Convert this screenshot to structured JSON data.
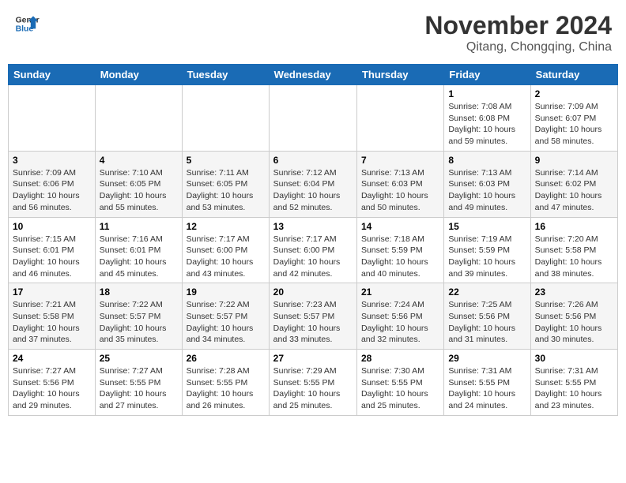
{
  "header": {
    "logo_line1": "General",
    "logo_line2": "Blue",
    "month": "November 2024",
    "location": "Qitang, Chongqing, China"
  },
  "weekdays": [
    "Sunday",
    "Monday",
    "Tuesday",
    "Wednesday",
    "Thursday",
    "Friday",
    "Saturday"
  ],
  "weeks": [
    [
      {
        "day": "",
        "info": ""
      },
      {
        "day": "",
        "info": ""
      },
      {
        "day": "",
        "info": ""
      },
      {
        "day": "",
        "info": ""
      },
      {
        "day": "",
        "info": ""
      },
      {
        "day": "1",
        "info": "Sunrise: 7:08 AM\nSunset: 6:08 PM\nDaylight: 10 hours and 59 minutes."
      },
      {
        "day": "2",
        "info": "Sunrise: 7:09 AM\nSunset: 6:07 PM\nDaylight: 10 hours and 58 minutes."
      }
    ],
    [
      {
        "day": "3",
        "info": "Sunrise: 7:09 AM\nSunset: 6:06 PM\nDaylight: 10 hours and 56 minutes."
      },
      {
        "day": "4",
        "info": "Sunrise: 7:10 AM\nSunset: 6:05 PM\nDaylight: 10 hours and 55 minutes."
      },
      {
        "day": "5",
        "info": "Sunrise: 7:11 AM\nSunset: 6:05 PM\nDaylight: 10 hours and 53 minutes."
      },
      {
        "day": "6",
        "info": "Sunrise: 7:12 AM\nSunset: 6:04 PM\nDaylight: 10 hours and 52 minutes."
      },
      {
        "day": "7",
        "info": "Sunrise: 7:13 AM\nSunset: 6:03 PM\nDaylight: 10 hours and 50 minutes."
      },
      {
        "day": "8",
        "info": "Sunrise: 7:13 AM\nSunset: 6:03 PM\nDaylight: 10 hours and 49 minutes."
      },
      {
        "day": "9",
        "info": "Sunrise: 7:14 AM\nSunset: 6:02 PM\nDaylight: 10 hours and 47 minutes."
      }
    ],
    [
      {
        "day": "10",
        "info": "Sunrise: 7:15 AM\nSunset: 6:01 PM\nDaylight: 10 hours and 46 minutes."
      },
      {
        "day": "11",
        "info": "Sunrise: 7:16 AM\nSunset: 6:01 PM\nDaylight: 10 hours and 45 minutes."
      },
      {
        "day": "12",
        "info": "Sunrise: 7:17 AM\nSunset: 6:00 PM\nDaylight: 10 hours and 43 minutes."
      },
      {
        "day": "13",
        "info": "Sunrise: 7:17 AM\nSunset: 6:00 PM\nDaylight: 10 hours and 42 minutes."
      },
      {
        "day": "14",
        "info": "Sunrise: 7:18 AM\nSunset: 5:59 PM\nDaylight: 10 hours and 40 minutes."
      },
      {
        "day": "15",
        "info": "Sunrise: 7:19 AM\nSunset: 5:59 PM\nDaylight: 10 hours and 39 minutes."
      },
      {
        "day": "16",
        "info": "Sunrise: 7:20 AM\nSunset: 5:58 PM\nDaylight: 10 hours and 38 minutes."
      }
    ],
    [
      {
        "day": "17",
        "info": "Sunrise: 7:21 AM\nSunset: 5:58 PM\nDaylight: 10 hours and 37 minutes."
      },
      {
        "day": "18",
        "info": "Sunrise: 7:22 AM\nSunset: 5:57 PM\nDaylight: 10 hours and 35 minutes."
      },
      {
        "day": "19",
        "info": "Sunrise: 7:22 AM\nSunset: 5:57 PM\nDaylight: 10 hours and 34 minutes."
      },
      {
        "day": "20",
        "info": "Sunrise: 7:23 AM\nSunset: 5:57 PM\nDaylight: 10 hours and 33 minutes."
      },
      {
        "day": "21",
        "info": "Sunrise: 7:24 AM\nSunset: 5:56 PM\nDaylight: 10 hours and 32 minutes."
      },
      {
        "day": "22",
        "info": "Sunrise: 7:25 AM\nSunset: 5:56 PM\nDaylight: 10 hours and 31 minutes."
      },
      {
        "day": "23",
        "info": "Sunrise: 7:26 AM\nSunset: 5:56 PM\nDaylight: 10 hours and 30 minutes."
      }
    ],
    [
      {
        "day": "24",
        "info": "Sunrise: 7:27 AM\nSunset: 5:56 PM\nDaylight: 10 hours and 29 minutes."
      },
      {
        "day": "25",
        "info": "Sunrise: 7:27 AM\nSunset: 5:55 PM\nDaylight: 10 hours and 27 minutes."
      },
      {
        "day": "26",
        "info": "Sunrise: 7:28 AM\nSunset: 5:55 PM\nDaylight: 10 hours and 26 minutes."
      },
      {
        "day": "27",
        "info": "Sunrise: 7:29 AM\nSunset: 5:55 PM\nDaylight: 10 hours and 25 minutes."
      },
      {
        "day": "28",
        "info": "Sunrise: 7:30 AM\nSunset: 5:55 PM\nDaylight: 10 hours and 25 minutes."
      },
      {
        "day": "29",
        "info": "Sunrise: 7:31 AM\nSunset: 5:55 PM\nDaylight: 10 hours and 24 minutes."
      },
      {
        "day": "30",
        "info": "Sunrise: 7:31 AM\nSunset: 5:55 PM\nDaylight: 10 hours and 23 minutes."
      }
    ]
  ]
}
